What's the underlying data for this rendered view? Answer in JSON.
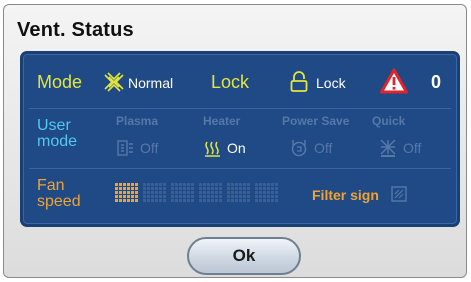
{
  "dialog": {
    "title": "Vent. Status"
  },
  "status_row": {
    "mode_label": "Mode",
    "mode_value": "Normal",
    "mode_icon": "normal-mode-icon",
    "lock_label": "Lock",
    "lock_value": "Lock",
    "lock_icon": "padlock-icon",
    "warning_icon": "warning-triangle-icon",
    "warning_count": "0"
  },
  "user_mode": {
    "label_line1": "User",
    "label_line2": "mode",
    "columns": [
      {
        "header": "Plasma",
        "value": "Off",
        "icon": "plasma-icon",
        "active": false
      },
      {
        "header": "Heater",
        "value": "On",
        "icon": "heater-icon",
        "active": true
      },
      {
        "header": "Power Save",
        "value": "Off",
        "icon": "power-save-icon",
        "active": false
      },
      {
        "header": "Quick",
        "value": "Off",
        "icon": "quick-icon",
        "active": false
      }
    ]
  },
  "fan": {
    "label_line1": "Fan",
    "label_line2": "speed",
    "level": 1,
    "max_level": 6,
    "filter_label": "Filter sign",
    "filter_icon": "filter-sign-icon"
  },
  "colors": {
    "panel_bg": "#1f4a86",
    "accent_yellow": "#e3e63c",
    "accent_cyan": "#52c8f0",
    "accent_orange": "#f2a230",
    "warning_red": "#e0242a"
  },
  "ok_button": {
    "label": "Ok"
  }
}
